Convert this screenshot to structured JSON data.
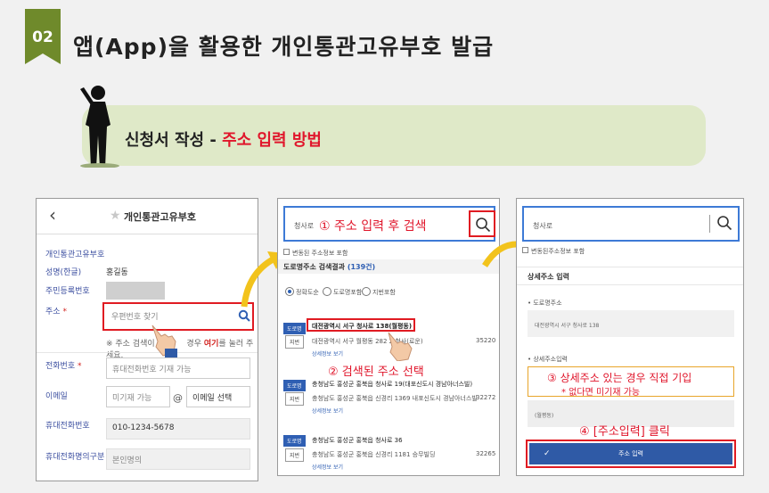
{
  "header": {
    "badge": "02",
    "title": "앱(App)을 활용한 개인통관고유부호 발급"
  },
  "subtitle": {
    "prefix": "신청서 작성 - ",
    "highlight": "주소 입력 방법"
  },
  "phone1": {
    "title": "개인통관고유부호",
    "rows": [
      {
        "label": "개인통관고유부호"
      },
      {
        "label": "성명(한글)",
        "value": "홍길동"
      },
      {
        "label": "주민등록번호"
      },
      {
        "label": "주소",
        "required": "*"
      },
      {
        "label": "전화번호",
        "required": "*"
      },
      {
        "label": "이메일"
      },
      {
        "label": "휴대전화번호"
      },
      {
        "label": "휴대전화명의구분"
      }
    ],
    "zip_placeholder": "우편번호 찾기",
    "note_prefix": "※ 주소 검색이",
    "note_mid": "경우",
    "note_link": "여기",
    "note_suffix": "를 눌러 주세요.",
    "phone_placeholder": "휴대전화번호 기재 가능",
    "email_placeholder": "미기재 가능",
    "email_at": "@",
    "email_domain": "이메일 선택",
    "mobile_value": "010-1234-5678",
    "owner_value": "본인명의"
  },
  "phone2": {
    "search_value": "청사로",
    "step1": "① 주소 입력 후 검색",
    "checkbox_label": "변동된 주소정보 포함",
    "result_title": "도로명주소 검색결과",
    "result_count": "(139건)",
    "radio_options": [
      "정확도순",
      "도로명포함",
      "지번포함"
    ],
    "results": [
      {
        "tag_road": "도로명",
        "road": "대전광역시 서구 청사로 138(월평동)",
        "tag_lot": "지번",
        "lot": "대전광역시 서구 월평동 282 2 청사(로운)",
        "zip": "35220",
        "more": "상세정보 보기"
      },
      {
        "tag_road": "도로명",
        "road": "충청남도 홍성군 홍북읍 청사로 19(대포신도시 경남아너스빌)",
        "tag_lot": "지번",
        "lot": "충청남도 홍성군 홍북읍 신경리 1369 내포신도시 경남아너스빌",
        "zip": "32272",
        "more": "상세정보 보기"
      },
      {
        "tag_road": "도로명",
        "road": "충청남도 홍성군 홍북읍 청사로 36",
        "tag_lot": "지번",
        "lot": "충청남도 홍성군 홍북읍 신경리 1181 승무빌딩",
        "zip": "32265",
        "more": "상세정보 보기"
      }
    ],
    "step2": "② 검색된 주소 선택"
  },
  "phone3": {
    "search_value": "청사로",
    "checkbox_label": "변동된주소정보 포함",
    "section_title": "상세주소 입력",
    "road_label": "도로명주소",
    "road_value": "대전광역시 서구 청사로 138",
    "detail_label": "상세주소입력",
    "step3": "③ 상세주소 있는 경우 직접 기입",
    "step3_note": "* 없다면 미기재 가능",
    "detail_value": "(월평동)",
    "step4": "④ [주소입력] 클릭",
    "submit": "주소 입력"
  },
  "colors": {
    "accent_green": "#6f8a2b",
    "highlight_red": "#e0162b",
    "primary_blue": "#2f5aa6"
  }
}
